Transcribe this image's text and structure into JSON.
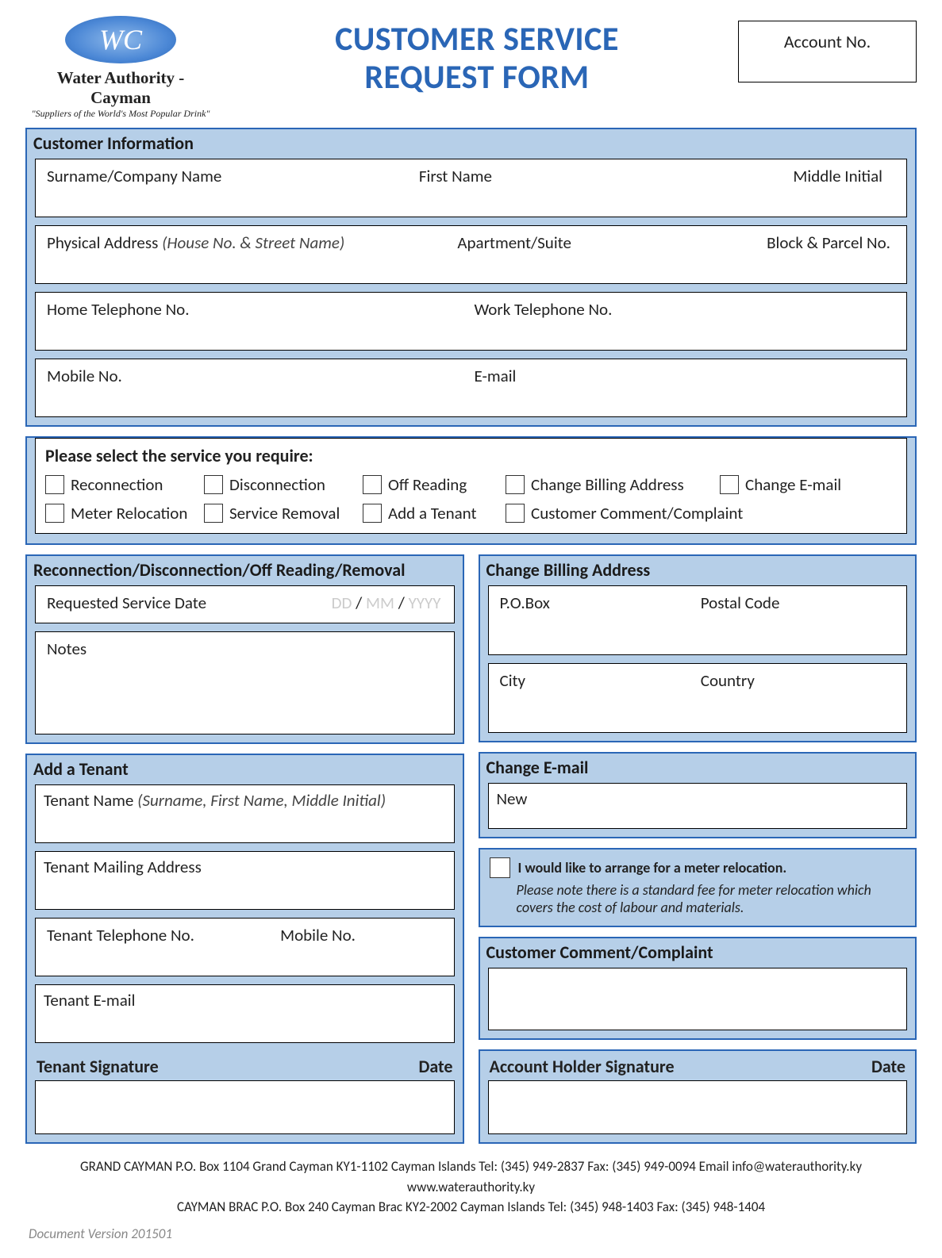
{
  "logo": {
    "monogram": "WC",
    "name": "Water Authority - Cayman",
    "tagline": "\"Suppliers of the World's Most Popular Drink\""
  },
  "title_line1": "CUSTOMER SERVICE",
  "title_line2": "REQUEST FORM",
  "account_label": "Account No.",
  "cust_info": {
    "header": "Customer Information",
    "surname_label": "Surname/Company Name",
    "firstname_label": "First Name",
    "middle_label": "Middle Initial",
    "address_label": "Physical Address ",
    "address_hint": "(House No. & Street Name)",
    "apt_label": "Apartment/Suite",
    "block_label": "Block & Parcel No.",
    "home_tel_label": "Home Telephone No.",
    "work_tel_label": "Work Telephone No.",
    "mobile_label": "Mobile No.",
    "email_label": "E-mail"
  },
  "svc": {
    "header": "Please select the service you require:",
    "options": [
      "Reconnection",
      "Disconnection",
      "Off Reading",
      "Change Billing Address",
      "Change E-mail",
      "Meter Relocation",
      "Service Removal",
      "Add a Tenant",
      "Customer Comment/Complaint"
    ]
  },
  "recon": {
    "header": "Reconnection/Disconnection/Off Reading/Removal",
    "reqdate_label": "Requested Service Date",
    "dd": "DD",
    "mm": "MM",
    "yyyy": "YYYY",
    "sep": " / ",
    "notes_label": "Notes"
  },
  "tenant": {
    "header": "Add a Tenant",
    "name_label": "Tenant Name ",
    "name_hint": "(Surname, First Name, Middle Initial)",
    "mail_label": "Tenant Mailing Address",
    "tel_label": "Tenant Telephone No.",
    "mobile_label": "Mobile No.",
    "email_label": "Tenant E-mail",
    "sig_label": "Tenant Signature",
    "date_label": "Date"
  },
  "billing": {
    "header": "Change Billing Address",
    "pobox_label": "P.O.Box",
    "postal_label": "Postal Code",
    "city_label": "City",
    "country_label": "Country"
  },
  "cemail": {
    "header": "Change E-mail",
    "new_label": "New"
  },
  "meter": {
    "line1": "I would like to arrange for a meter relocation.",
    "note": "Please note there is a standard fee for meter relocation which covers the cost of labour and materials."
  },
  "comment": {
    "header": "Customer Comment/Complaint"
  },
  "acct_sig": {
    "sig_label": "Account Holder Signature",
    "date_label": "Date"
  },
  "footer": {
    "line1": "GRAND CAYMAN P.O. Box 1104 Grand Cayman KY1-1102 Cayman Islands Tel: (345) 949-2837 Fax: (345) 949-0094 Email info@waterauthority.ky www.waterauthority.ky",
    "line2": "CAYMAN BRAC P.O. Box 240 Cayman Brac KY2-2002 Cayman Islands Tel: (345) 948-1403 Fax: (345) 948-1404"
  },
  "docver": "Document Version 201501"
}
